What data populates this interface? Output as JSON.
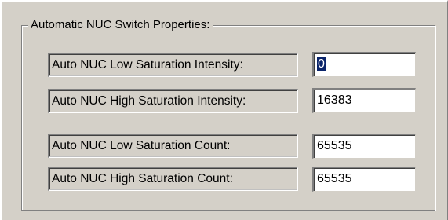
{
  "group": {
    "title": "Automatic NUC Switch Properties:"
  },
  "rows": [
    {
      "label": "Auto NUC Low Saturation Intensity:",
      "value": "0",
      "focused": true
    },
    {
      "label": "Auto NUC High Saturation Intensity:",
      "value": "16383"
    },
    {
      "label": "Auto NUC Low Saturation Count:",
      "value": "65535"
    },
    {
      "label": "Auto NUC High Saturation Count:",
      "value": "65535"
    }
  ],
  "colors": {
    "dialog_bg": "#d4d0c8",
    "selection_bg": "#0a246a",
    "field_bg": "#ffffff"
  }
}
